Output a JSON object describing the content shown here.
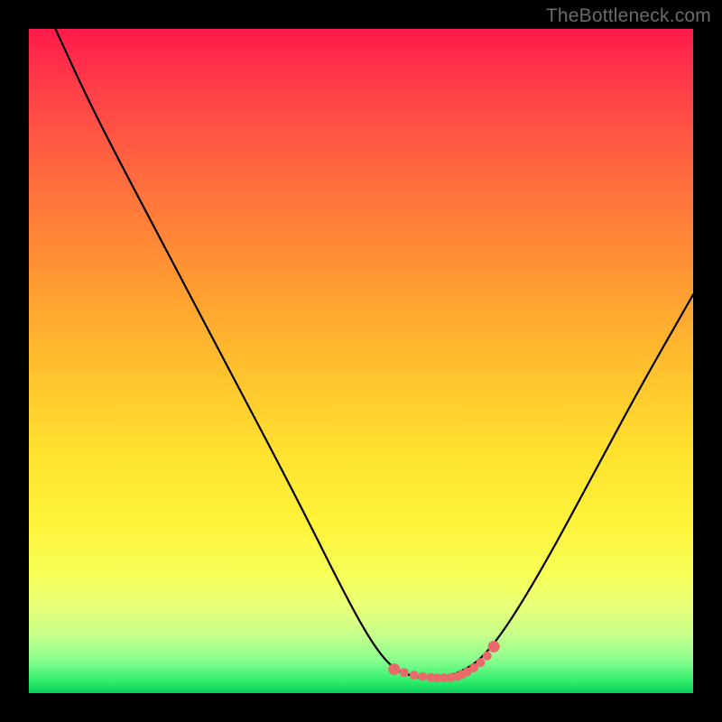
{
  "watermark": "TheBottleneck.com",
  "chart_data": {
    "type": "line",
    "title": "",
    "xlabel": "",
    "ylabel": "",
    "xlim": [
      0,
      100
    ],
    "ylim": [
      0,
      100
    ],
    "series": [
      {
        "name": "bottleneck-curve",
        "x": [
          4,
          10,
          20,
          30,
          40,
          48,
          52,
          55,
          58,
          60,
          63,
          65,
          68,
          72,
          78,
          85,
          92,
          100
        ],
        "values": [
          100,
          87,
          68,
          49,
          30,
          14,
          7,
          3.5,
          2.5,
          2.3,
          2.5,
          3.2,
          5,
          10,
          20,
          33,
          46,
          60
        ]
      }
    ],
    "markers": {
      "name": "plateau-dots",
      "color": "#e96a6a",
      "x": [
        55,
        56.5,
        58,
        59.3,
        60.5,
        61.5,
        62.5,
        63.5,
        64.5,
        65.2,
        66,
        67,
        68,
        69,
        70
      ],
      "values": [
        3.6,
        3.1,
        2.7,
        2.5,
        2.35,
        2.3,
        2.3,
        2.35,
        2.5,
        2.8,
        3.2,
        3.8,
        4.6,
        5.6,
        7.0
      ]
    }
  }
}
